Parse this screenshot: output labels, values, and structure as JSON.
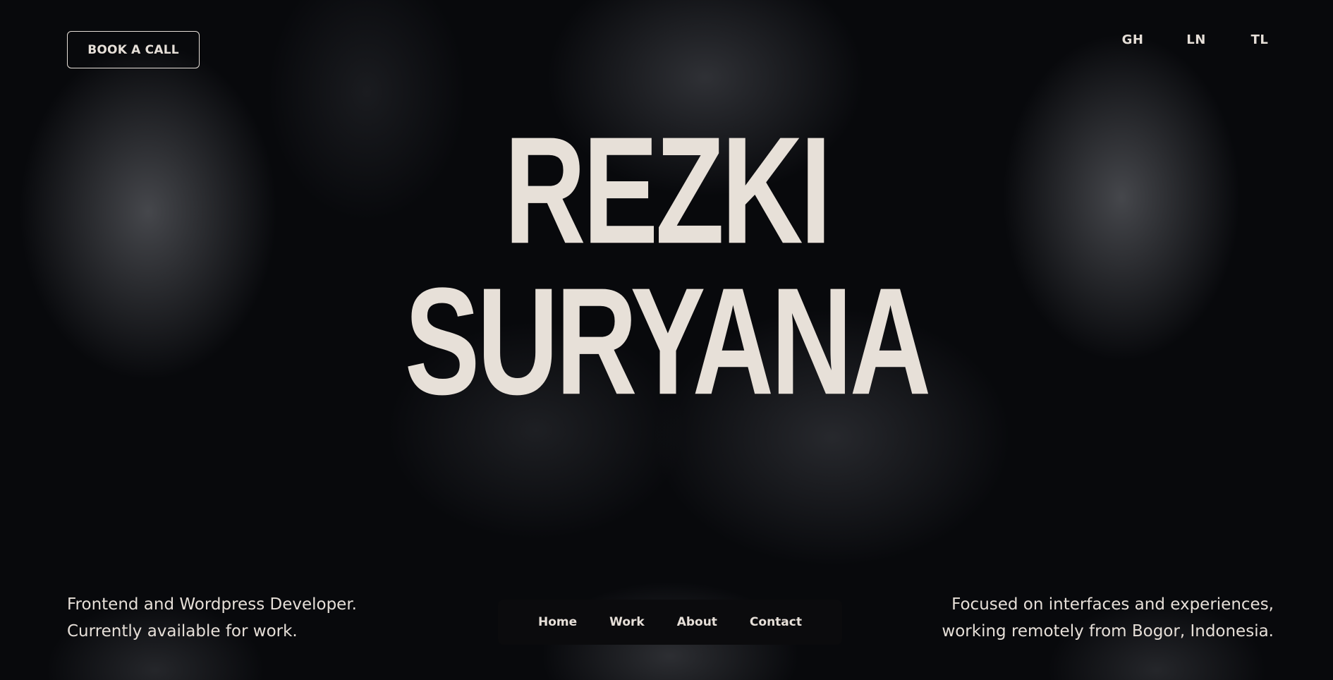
{
  "header": {
    "book_call_label": "BOOK A CALL",
    "social": [
      "GH",
      "LN",
      "TL"
    ]
  },
  "hero": {
    "first_name": "REZKI",
    "last_name": "SURYANA"
  },
  "bio_left": {
    "line1": "Frontend and Wordpress Developer.",
    "line2": "Currently available for work."
  },
  "bio_right": {
    "line1": "Focused on interfaces and experiences,",
    "line2": "working remotely from Bogor, Indonesia."
  },
  "nav": {
    "items": [
      "Home",
      "Work",
      "About",
      "Contact"
    ]
  },
  "colors": {
    "background": "#08090c",
    "text": "#e6dfd8",
    "navbar_bg": "#0b0b0d"
  }
}
